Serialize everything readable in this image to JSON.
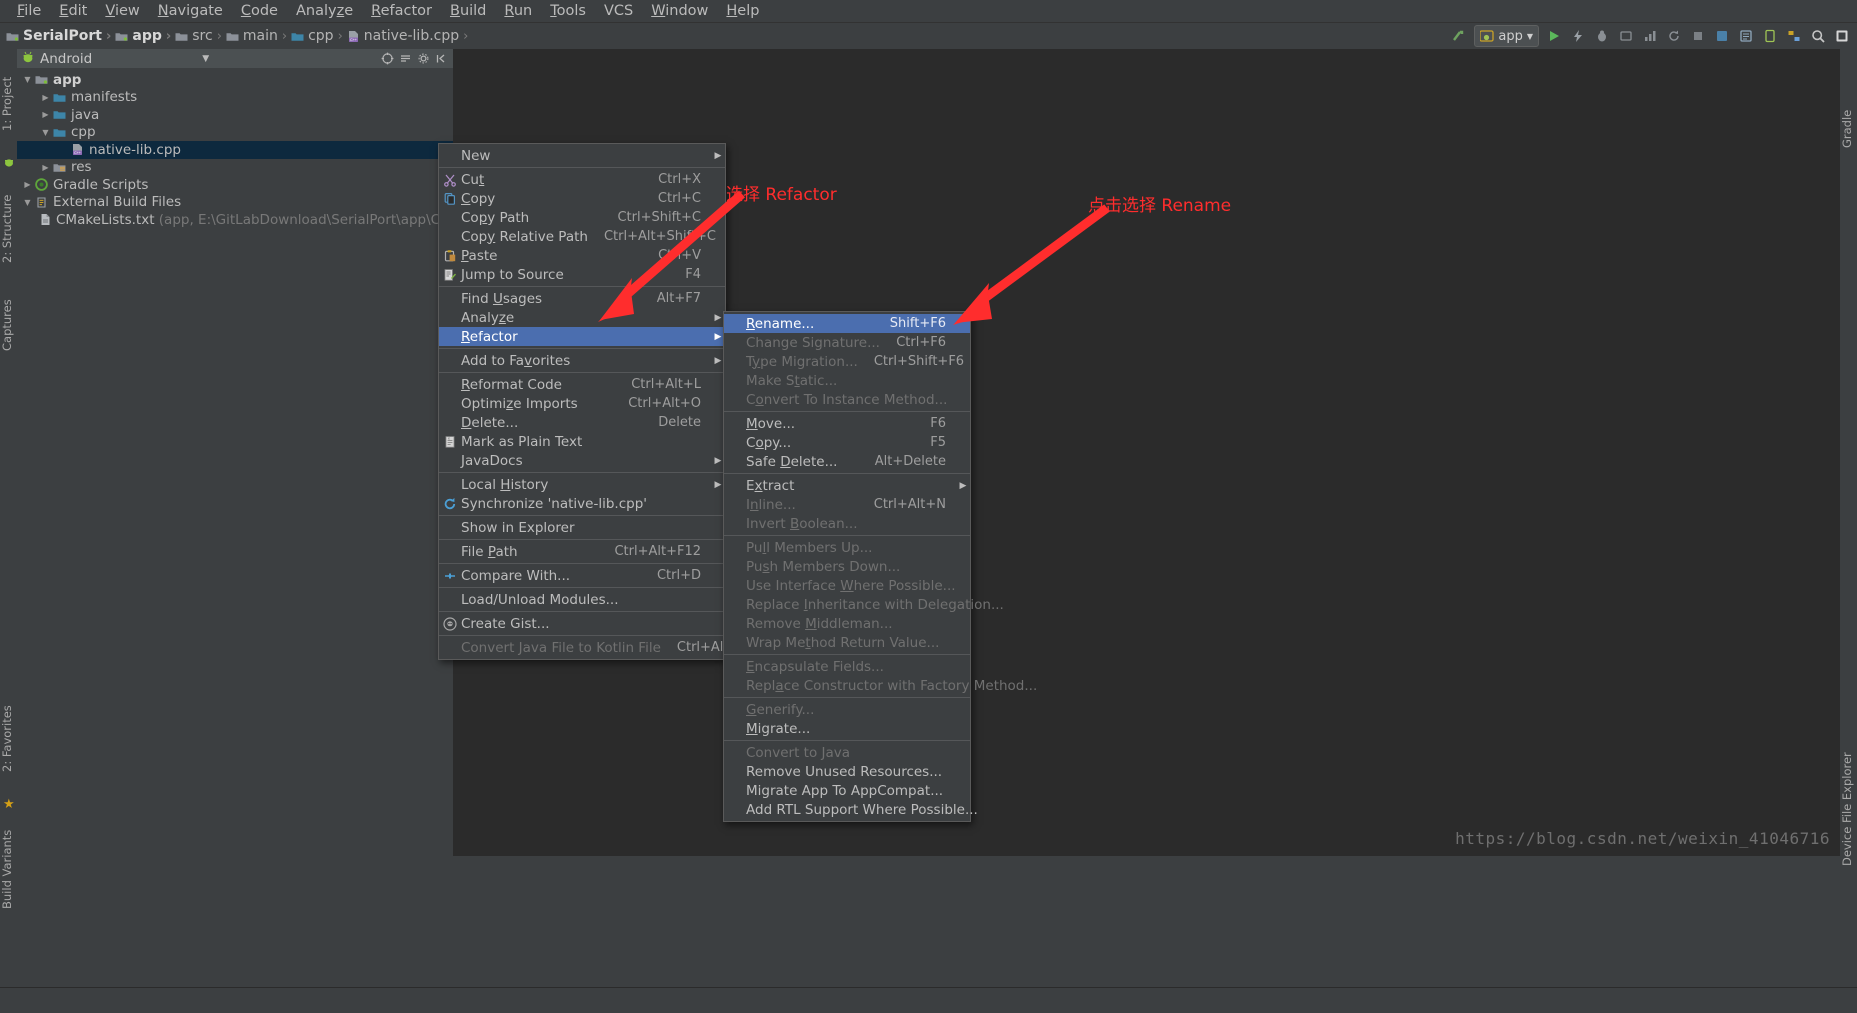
{
  "menubar": {
    "items": [
      "File",
      "Edit",
      "View",
      "Navigate",
      "Code",
      "Analyze",
      "Refactor",
      "Build",
      "Run",
      "Tools",
      "VCS",
      "Window",
      "Help"
    ]
  },
  "breadcrumb": {
    "items": [
      {
        "label": "SerialPort",
        "icon": "module-icon",
        "bold": true
      },
      {
        "label": "app",
        "icon": "android-module-icon",
        "bold": true
      },
      {
        "label": "src",
        "icon": "folder-icon",
        "bold": false
      },
      {
        "label": "main",
        "icon": "folder-icon",
        "bold": false
      },
      {
        "label": "cpp",
        "icon": "folder-blue-icon",
        "bold": false
      },
      {
        "label": "native-lib.cpp",
        "icon": "cpp-file-icon",
        "bold": false
      }
    ],
    "separator": "›"
  },
  "toolbar_right": {
    "run_config": "app",
    "icons": [
      "sync-icon",
      "run-icon",
      "debug-icon",
      "attach-debugger-icon",
      "profile-icon",
      "stop-icon",
      "avd-manager-icon",
      "sdk-manager-icon",
      "project-structure-icon",
      "search-icon",
      "layout-inspector-icon"
    ]
  },
  "left_rail": {
    "items": [
      "1: Project",
      "2: Structure",
      "Captures",
      "2: Favorites",
      "Build Variants"
    ]
  },
  "right_rail": {
    "items": [
      "Gradle",
      "Device File Explorer"
    ]
  },
  "project_panel": {
    "title": "Android",
    "header_icons": [
      "target-icon",
      "collapse-all-icon",
      "settings-icon",
      "hide-icon"
    ],
    "tree": [
      {
        "label": "app",
        "indent": 0,
        "arrow": "down",
        "icon": "module-icon",
        "bold": true,
        "selected": false
      },
      {
        "label": "manifests",
        "indent": 1,
        "arrow": "right",
        "icon": "folder-blue-icon",
        "bold": false,
        "selected": false
      },
      {
        "label": "java",
        "indent": 1,
        "arrow": "right",
        "icon": "folder-blue-icon",
        "bold": false,
        "selected": false
      },
      {
        "label": "cpp",
        "indent": 1,
        "arrow": "down",
        "icon": "folder-blue-icon",
        "bold": false,
        "selected": false
      },
      {
        "label": "native-lib.cpp",
        "indent": 2,
        "arrow": "none",
        "icon": "cpp-file-icon",
        "bold": false,
        "selected": true
      },
      {
        "label": "res",
        "indent": 1,
        "arrow": "right",
        "icon": "res-folder-icon",
        "bold": false,
        "selected": false
      },
      {
        "label": "Gradle Scripts",
        "indent": 0,
        "arrow": "right",
        "icon": "gradle-icon",
        "bold": false,
        "selected": false
      },
      {
        "label": "External Build Files",
        "indent": 0,
        "arrow": "down",
        "icon": "build-files-icon",
        "bold": false,
        "selected": false
      },
      {
        "label": "CMakeLists.txt",
        "sub": "(app, E:\\GitLabDownload\\SerialPort\\app\\CMakeLists.txt)",
        "indent": 1,
        "arrow": "none",
        "icon": "cmake-file-icon",
        "bold": false,
        "selected": false
      }
    ]
  },
  "context_menu": {
    "items": [
      {
        "label": "New",
        "icon": "",
        "key": "",
        "submenu": true,
        "disabled": false,
        "highlight": false
      },
      {
        "sep": true
      },
      {
        "label": "Cut",
        "icon": "cut-icon",
        "key": "Ctrl+X",
        "underline": "t"
      },
      {
        "label": "Copy",
        "icon": "copy-icon",
        "key": "Ctrl+C",
        "underline": "C"
      },
      {
        "label": "Copy Path",
        "icon": "",
        "key": "Ctrl+Shift+C",
        "underline": "p"
      },
      {
        "label": "Copy Relative Path",
        "icon": "",
        "key": "Ctrl+Alt+Shift+C",
        "underline": "y"
      },
      {
        "label": "Paste",
        "icon": "paste-icon",
        "key": "Ctrl+V",
        "underline": "P"
      },
      {
        "label": "Jump to Source",
        "icon": "jump-to-source-icon",
        "key": "F4",
        "underline": "J"
      },
      {
        "sep": true
      },
      {
        "label": "Find Usages",
        "icon": "",
        "key": "Alt+F7",
        "underline": "U"
      },
      {
        "label": "Analyze",
        "icon": "",
        "key": "",
        "submenu": true,
        "underline": "z"
      },
      {
        "label": "Refactor",
        "icon": "",
        "key": "",
        "submenu": true,
        "highlight": true,
        "underline": "R"
      },
      {
        "sep": true
      },
      {
        "label": "Add to Favorites",
        "icon": "",
        "key": "",
        "submenu": true,
        "underline": "v"
      },
      {
        "sep": true
      },
      {
        "label": "Reformat Code",
        "icon": "",
        "key": "Ctrl+Alt+L",
        "underline": "R"
      },
      {
        "label": "Optimize Imports",
        "icon": "",
        "key": "Ctrl+Alt+O",
        "underline": "z"
      },
      {
        "label": "Delete...",
        "icon": "",
        "key": "Delete",
        "underline": "D"
      },
      {
        "label": "Mark as Plain Text",
        "icon": "plain-text-icon",
        "key": ""
      },
      {
        "label": "JavaDocs",
        "icon": "",
        "key": "",
        "submenu": true,
        "underline": "J"
      },
      {
        "sep": true
      },
      {
        "label": "Local History",
        "icon": "",
        "key": "",
        "submenu": true,
        "underline": "H"
      },
      {
        "label": "Synchronize 'native-lib.cpp'",
        "icon": "synchronize-icon",
        "key": ""
      },
      {
        "sep": true
      },
      {
        "label": "Show in Explorer",
        "icon": "",
        "key": ""
      },
      {
        "sep": true
      },
      {
        "label": "File Path",
        "icon": "",
        "key": "Ctrl+Alt+F12",
        "underline": "P"
      },
      {
        "sep": true
      },
      {
        "label": "Compare With...",
        "icon": "compare-icon",
        "key": "Ctrl+D"
      },
      {
        "sep": true
      },
      {
        "label": "Load/Unload Modules...",
        "icon": "",
        "key": ""
      },
      {
        "sep": true
      },
      {
        "label": "Create Gist...",
        "icon": "github-icon",
        "key": ""
      },
      {
        "sep": true
      },
      {
        "label": "Convert Java File to Kotlin File",
        "icon": "",
        "key": "Ctrl+Alt+Shift+K",
        "disabled": true
      }
    ]
  },
  "refactor_submenu": {
    "items": [
      {
        "label": "Rename...",
        "key": "Shift+F6",
        "highlight": true,
        "underline": "R"
      },
      {
        "label": "Change Signature...",
        "key": "Ctrl+F6",
        "disabled": true
      },
      {
        "label": "Type Migration...",
        "key": "Ctrl+Shift+F6",
        "disabled": true,
        "underline": "y"
      },
      {
        "label": "Make Static...",
        "key": "",
        "disabled": true,
        "underline": "t"
      },
      {
        "label": "Convert To Instance Method...",
        "key": "",
        "disabled": true,
        "underline": "o"
      },
      {
        "sep": true
      },
      {
        "label": "Move...",
        "key": "F6",
        "underline": "M"
      },
      {
        "label": "Copy...",
        "key": "F5",
        "underline": "o"
      },
      {
        "label": "Safe Delete...",
        "key": "Alt+Delete",
        "underline": "D"
      },
      {
        "sep": true
      },
      {
        "label": "Extract",
        "key": "",
        "submenu": true,
        "underline": "x"
      },
      {
        "label": "Inline...",
        "key": "Ctrl+Alt+N",
        "disabled": true,
        "underline": "n"
      },
      {
        "label": "Invert Boolean...",
        "key": "",
        "disabled": true,
        "underline": "B"
      },
      {
        "sep": true
      },
      {
        "label": "Pull Members Up...",
        "key": "",
        "disabled": true,
        "underline": "l"
      },
      {
        "label": "Push Members Down...",
        "key": "",
        "disabled": true,
        "underline": "s"
      },
      {
        "label": "Use Interface Where Possible...",
        "key": "",
        "disabled": true,
        "underline": "W"
      },
      {
        "label": "Replace Inheritance with Delegation...",
        "key": "",
        "disabled": true,
        "underline": "I"
      },
      {
        "label": "Remove Middleman...",
        "key": "",
        "disabled": true,
        "underline": "M"
      },
      {
        "label": "Wrap Method Return Value...",
        "key": "",
        "disabled": true,
        "underline": "t"
      },
      {
        "sep": true
      },
      {
        "label": "Encapsulate Fields...",
        "key": "",
        "disabled": true,
        "underline": "E"
      },
      {
        "label": "Replace Constructor with Factory Method...",
        "key": "",
        "disabled": true,
        "underline": "a"
      },
      {
        "sep": true
      },
      {
        "label": "Generify...",
        "key": "",
        "disabled": true,
        "underline": "G"
      },
      {
        "label": "Migrate...",
        "key": "",
        "underline": "M"
      },
      {
        "sep": true
      },
      {
        "label": "Convert to Java",
        "key": "",
        "disabled": true
      },
      {
        "label": "Remove Unused Resources...",
        "key": ""
      },
      {
        "label": "Migrate App To AppCompat...",
        "key": ""
      },
      {
        "label": "Add RTL Support Where Possible...",
        "key": ""
      }
    ]
  },
  "annotations": [
    {
      "text": "选择 Refactor",
      "color": "#ff2d2d"
    },
    {
      "text": "点击选择 Rename",
      "color": "#ff2d2d"
    }
  ],
  "watermark": "https://blog.csdn.net/weixin_41046716",
  "colors": {
    "accent_highlight": "#4b6eaf",
    "selection": "#0d293e",
    "panel_bg": "#3c3f41",
    "editor_bg": "#2b2b2b",
    "annotation_red": "#ff2d2d"
  }
}
